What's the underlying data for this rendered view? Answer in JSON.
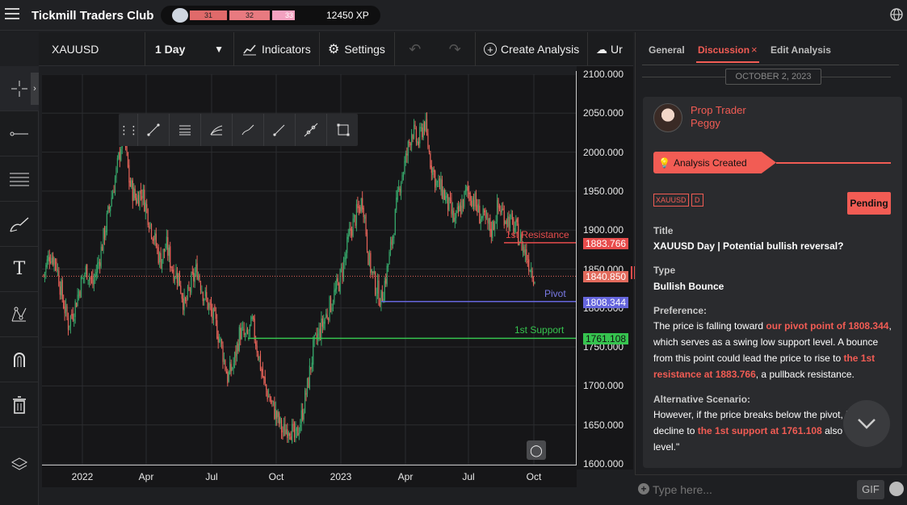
{
  "app": {
    "title": "Tickmill Traders Club"
  },
  "progress": {
    "segments": [
      "31",
      "32",
      "33"
    ],
    "xp": "12450 XP"
  },
  "toolbar": {
    "symbol": "XAUUSD",
    "timeframe": "1 Day",
    "indicators": "Indicators",
    "settings": "Settings",
    "create": "Create Analysis",
    "upload": "Ur"
  },
  "chart_data": {
    "type": "candlestick",
    "symbol": "XAUUSD",
    "yticks": [
      "2100.000",
      "2050.000",
      "2000.000",
      "1950.000",
      "1900.000",
      "1850.000",
      "1800.000",
      "1750.000",
      "1700.000",
      "1650.000",
      "1600.000"
    ],
    "xticks": [
      "2022",
      "Apr",
      "Jul",
      "Oct",
      "2023",
      "Apr",
      "Jul",
      "Oct"
    ],
    "ylim": [
      1600,
      2100
    ],
    "close_series": [
      1842,
      1870,
      1860,
      1815,
      1780,
      1800,
      1830,
      1850,
      1830,
      1860,
      1900,
      1940,
      1980,
      2030,
      1960,
      1940,
      1950,
      1920,
      1890,
      1860,
      1880,
      1850,
      1840,
      1800,
      1830,
      1850,
      1820,
      1800,
      1780,
      1750,
      1710,
      1730,
      1770,
      1760,
      1780,
      1740,
      1700,
      1680,
      1660,
      1640,
      1650,
      1630,
      1660,
      1700,
      1750,
      1770,
      1790,
      1810,
      1830,
      1860,
      1900,
      1920,
      1940,
      1860,
      1830,
      1810,
      1850,
      1900,
      1960,
      1990,
      2030,
      2010,
      2040,
      1990,
      1960,
      1950,
      1930,
      1910,
      1930,
      1950,
      1940,
      1920,
      1910,
      1900,
      1930,
      1920,
      1910,
      1900,
      1880,
      1860,
      1840
    ],
    "levels": [
      {
        "name": "1st Resistance",
        "value": "1883.766",
        "color": "#e84c4c"
      },
      {
        "name": "Pivot",
        "value": "1808.344",
        "color": "#6666dd"
      },
      {
        "name": "1st Support",
        "value": "1761.108",
        "color": "#36c44f"
      }
    ],
    "last_price": "1840.850"
  },
  "panel": {
    "tabs": [
      "General",
      "Discussion",
      "Edit Analysis"
    ],
    "date": "OCTOBER 2, 2023",
    "user": {
      "role": "Prop Trader",
      "name": "Peggy"
    },
    "banner": "Analysis Created",
    "tags": [
      "XAUUSD",
      "D"
    ],
    "status": "Pending",
    "title_label": "Title",
    "title_value": "XAUUSD Day | Potential bullish reversal?",
    "type_label": "Type",
    "type_value": "Bullish Bounce",
    "pref_label": "Preference:",
    "pref": {
      "a": "The price is falling toward ",
      "b": "our pivot point of 1808.344",
      "c": ", which serves as a swing low support level. A bounce from this point could lead the price to rise to ",
      "d": "the 1st resistance at 1883.766",
      "e": ", a pullback resistance."
    },
    "alt_label": "Alternative Scenario:",
    "alt": {
      "a": " However, if the price breaks below the pivot, it could decline to ",
      "b": "the 1st support at 1761.108",
      "c": " also a support level.\""
    },
    "input_placeholder": "Type here...",
    "gif": "GIF"
  }
}
